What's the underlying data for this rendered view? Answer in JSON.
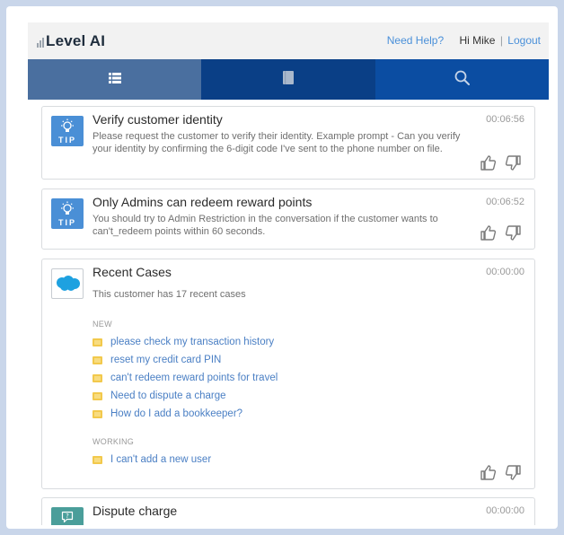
{
  "header": {
    "brand": "Level AI",
    "help_link": "Need Help?",
    "greeting": "Hi Mike",
    "separator": "|",
    "logout": "Logout"
  },
  "nav": {
    "tabs": [
      {
        "icon": "list-icon",
        "active": true
      },
      {
        "icon": "book-icon",
        "active": false
      },
      {
        "icon": "search-icon",
        "active": false
      }
    ]
  },
  "cards": [
    {
      "badge": "TIP",
      "icon": "lightbulb-icon",
      "title": "Verify customer identity",
      "time": "00:06:56",
      "body": "Please request the customer to verify their identity. Example prompt - Can you verify your identity by confirming the 6-digit code I've sent to the phone number on file."
    },
    {
      "badge": "TIP",
      "icon": "lightbulb-icon",
      "title": "Only Admins can redeem reward points",
      "time": "00:06:52",
      "body": "You should try to Admin Restriction in the conversation if the customer wants to can't_redeem points within 60 seconds."
    },
    {
      "icon": "salesforce-icon",
      "title": "Recent Cases",
      "time": "00:00:00",
      "body": "This customer has 17 recent cases",
      "groups": [
        {
          "label": "NEW",
          "items": [
            "please check my transaction history",
            "reset my credit card PIN",
            "can't redeem reward points for travel",
            "Need to dispute a charge",
            "How do I add a bookkeeper?"
          ]
        },
        {
          "label": "WORKING",
          "items": [
            "I can't add a new user"
          ]
        }
      ]
    },
    {
      "icon": "chat-question-icon",
      "title": "Dispute charge",
      "time": "00:00:00"
    }
  ],
  "colors": {
    "nav_bg": "#0b4da2",
    "nav_active": "#4a6f9f",
    "tip_badge": "#4a8fd6",
    "link": "#4a90d9",
    "folder": "#f2c94c"
  }
}
